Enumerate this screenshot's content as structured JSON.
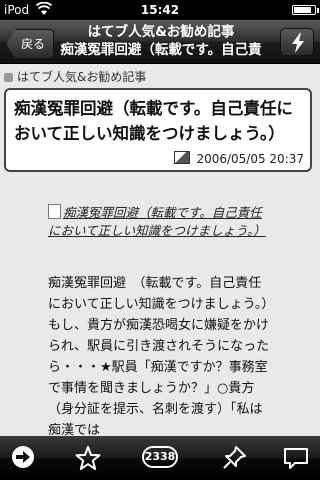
{
  "status": {
    "carrier": "iPod",
    "time": "15:42",
    "battery_level": 0.85
  },
  "nav": {
    "back_label": "戻る",
    "title_line1": "はてブ人気&お勧め記事",
    "title_line2": "痴漢冤罪回避（転載です。自己責",
    "action_icon": "lightning-bolt-icon"
  },
  "content": {
    "feed_name": "はてブ人気&お勧め記事",
    "entry": {
      "title": "痴漢冤罪回避（転載です。自己責任において正しい知識をつけましょう。）",
      "date": "2006/05/05 20:37"
    },
    "link_text": "痴漢冤罪回避（転載です。自己責任において正しい知識をつけましょう。）",
    "body": "痴漢冤罪回避　（転載です。自己責任において正しい知識をつけましょう。）　もし、貴方が痴漢恐喝女に嫌疑をかけられ、駅員に引き渡されそうになったら・・・★駅員「痴漢ですか？事務室で事情を聞きましょうか？」○貴方（身分証を提示、名刺を渡す）「私は痴漢では"
  },
  "tabbar": {
    "count": "2338",
    "icons": [
      "arrow-right-icon",
      "star-icon",
      "count-badge",
      "pin-icon",
      "comment-icon"
    ]
  }
}
